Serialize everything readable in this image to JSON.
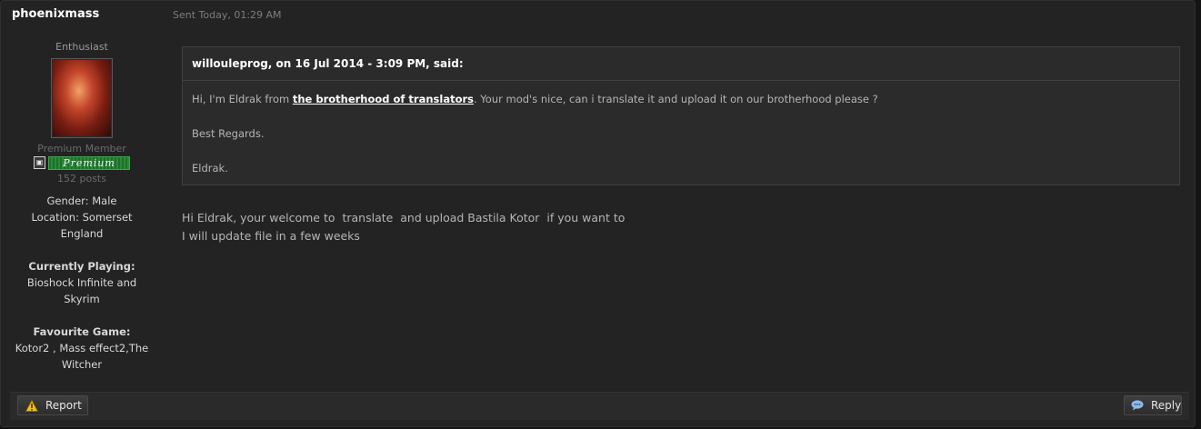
{
  "post": {
    "author": "phoenixmass",
    "sent": "Sent Today, 01:29 AM"
  },
  "profile": {
    "rank": "Enthusiast",
    "member_title": "Premium Member",
    "badge_label": "Premium",
    "posts": "152 posts",
    "gender": "Gender: Male",
    "location_line1": "Location: Somerset",
    "location_line2": "England",
    "playing_label": "Currently Playing:",
    "playing_line1": "Bioshock Infinite and",
    "playing_line2": "Skyrim",
    "favourite_label": "Favourite Game:",
    "favourite_line1": "Kotor2 , Mass effect2,The",
    "favourite_line2": "Witcher"
  },
  "quote": {
    "header": "willouleprog, on 16 Jul 2014 - 3:09 PM, said:",
    "line1_before": "Hi, I'm Eldrak from ",
    "line1_link": "the brotherhood of translators",
    "line1_after": ". Your mod's nice, can i translate it and upload it on our brotherhood please ?",
    "line2": "Best Regards.",
    "line3": "Eldrak."
  },
  "reply": {
    "line1": "Hi Eldrak, your welcome to  translate  and upload Bastila Kotor  if you want to",
    "line2": "I will update file in a few weeks"
  },
  "footer": {
    "report_label": "Report",
    "reply_label": "Reply"
  },
  "icons": {
    "report": "warning-icon",
    "reply": "speech-bubble-icon"
  },
  "colors": {
    "background": "#232323",
    "link": "#ffffff",
    "badge_green": "#2b8a3a",
    "warning_yellow": "#f2c314",
    "reply_icon_blue": "#8fb8e6"
  }
}
